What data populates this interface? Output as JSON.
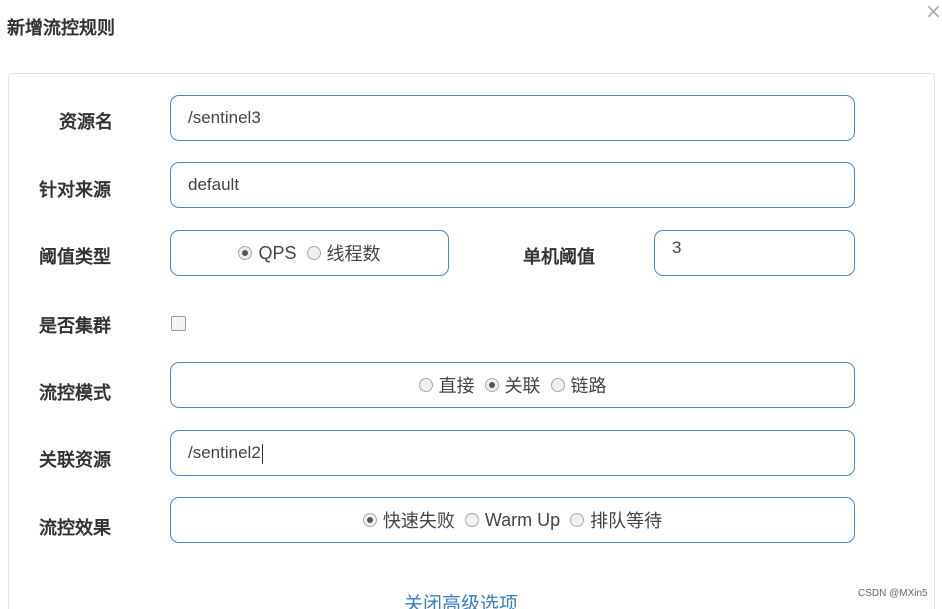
{
  "dialog": {
    "title": "新增流控规则",
    "close_symbol": "×"
  },
  "form": {
    "resource": {
      "label": "资源名",
      "value": "/sentinel3"
    },
    "limit_app": {
      "label": "针对来源",
      "value": "default"
    },
    "grade": {
      "label": "阈值类型",
      "options": [
        {
          "text": "QPS",
          "checked": true
        },
        {
          "text": "线程数",
          "checked": false
        }
      ]
    },
    "count": {
      "label": "单机阈值",
      "value": "3"
    },
    "cluster": {
      "label": "是否集群",
      "checked": false
    },
    "strategy": {
      "label": "流控模式",
      "options": [
        {
          "text": "直接",
          "checked": false
        },
        {
          "text": "关联",
          "checked": true
        },
        {
          "text": "链路",
          "checked": false
        }
      ]
    },
    "ref_resource": {
      "label": "关联资源",
      "value": "/sentinel2"
    },
    "control_behavior": {
      "label": "流控效果",
      "options": [
        {
          "text": "快速失败",
          "checked": true
        },
        {
          "text": "Warm Up",
          "checked": false
        },
        {
          "text": "排队等待",
          "checked": false
        }
      ]
    }
  },
  "advanced_link": "关闭高级选项",
  "watermark": "CSDN @MXin5"
}
